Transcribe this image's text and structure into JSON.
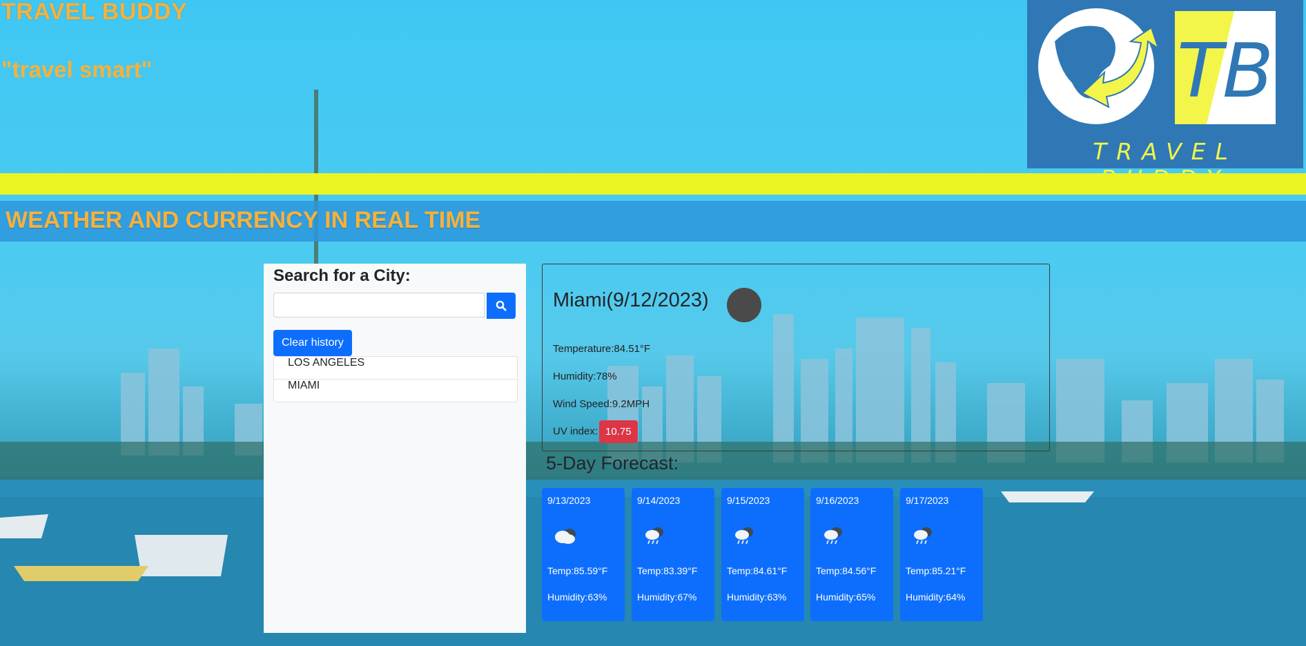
{
  "header": {
    "title": "TRAVEL BUDDY",
    "tagline": "\"travel smart\"",
    "logo": {
      "monogram": "TB",
      "text": "TRAVEL BUDDY"
    }
  },
  "subtitle": "WEATHER AND CURRENCY IN REAL TIME",
  "sidebar": {
    "search_label": "Search for a City:",
    "search_value": "",
    "search_icon": "search-icon",
    "clear_label": "Clear history",
    "history": [
      "LOS ANGELES",
      "MIAMI"
    ]
  },
  "current": {
    "city_date": "Miami(9/12/2023)",
    "icon": "weather-icon",
    "temperature": "Temperature:84.51°F",
    "humidity": "Humidity:78%",
    "wind": "Wind Speed:9.2MPH",
    "uv_label": "UV index:",
    "uv_value": "10.75",
    "uv_color": "#dc3545"
  },
  "forecast": {
    "title": "5-Day Forecast:",
    "days": [
      {
        "date": "9/13/2023",
        "icon": "cloud-icon",
        "temp": "Temp:85.59°F",
        "humidity": "Humidity:63%"
      },
      {
        "date": "9/14/2023",
        "icon": "rain-cloud-icon",
        "temp": "Temp:83.39°F",
        "humidity": "Humidity:67%"
      },
      {
        "date": "9/15/2023",
        "icon": "rain-cloud-icon",
        "temp": "Temp:84.61°F",
        "humidity": "Humidity:63%"
      },
      {
        "date": "9/16/2023",
        "icon": "rain-cloud-icon",
        "temp": "Temp:84.56°F",
        "humidity": "Humidity:65%"
      },
      {
        "date": "9/17/2023",
        "icon": "rain-cloud-icon",
        "temp": "Temp:85.21°F",
        "humidity": "Humidity:64%"
      }
    ]
  },
  "colors": {
    "brand_orange": "#f6b13c",
    "accent_yellow": "#ecf423",
    "primary_blue": "#0d6efd"
  }
}
